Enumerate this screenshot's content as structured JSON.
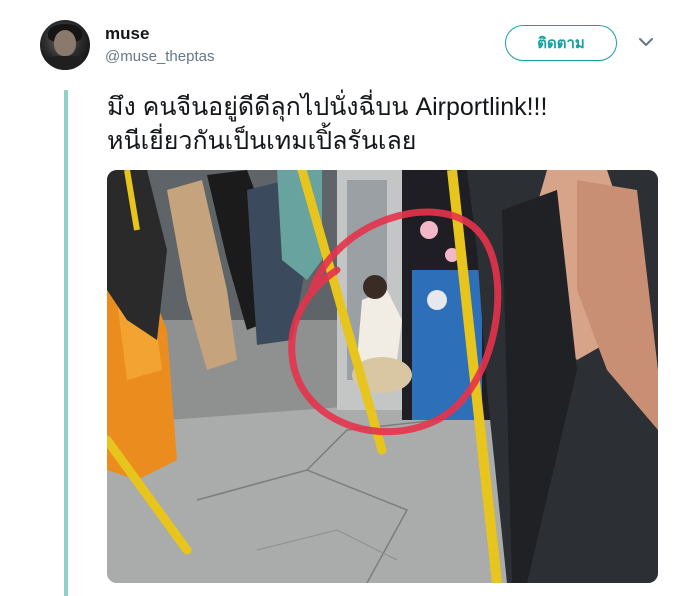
{
  "user": {
    "display_name": "muse",
    "handle": "@muse_theptas"
  },
  "actions": {
    "follow_label": "ติดตาม"
  },
  "tweet": {
    "text_line1": "มึง คนจีนอยู่ดีดีลุกไปนั่งฉี่บน Airportlink!!!",
    "text_line2": "หนีเยี่ยวกันเป็นเทมเปิ้ลรันเลย"
  },
  "colors": {
    "accent": "#17a2a0",
    "thread_line": "#8fd3c8",
    "text": "#14171a",
    "muted": "#657786",
    "circle_marker": "#e5334b"
  },
  "icons": {
    "menu": "chevron-down-icon"
  }
}
